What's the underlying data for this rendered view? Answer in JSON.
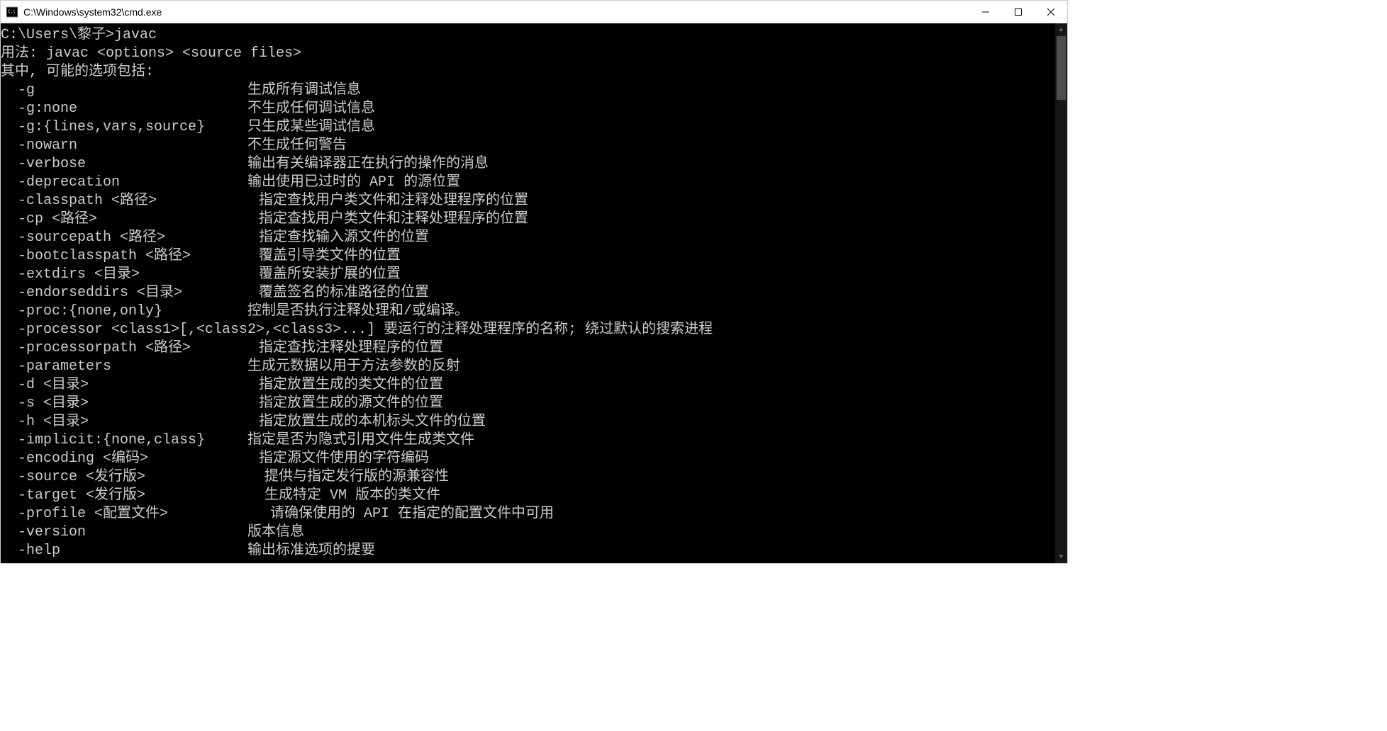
{
  "window": {
    "title": "C:\\Windows\\system32\\cmd.exe"
  },
  "terminal": {
    "prompt": "C:\\Users\\黎子>javac",
    "usage": "用法: javac <options> <source files>",
    "options_header": "其中, 可能的选项包括:",
    "options": [
      {
        "flag": "  -g                         ",
        "desc": "生成所有调试信息"
      },
      {
        "flag": "  -g:none                    ",
        "desc": "不生成任何调试信息"
      },
      {
        "flag": "  -g:{lines,vars,source}     ",
        "desc": "只生成某些调试信息"
      },
      {
        "flag": "  -nowarn                    ",
        "desc": "不生成任何警告"
      },
      {
        "flag": "  -verbose                   ",
        "desc": "输出有关编译器正在执行的操作的消息"
      },
      {
        "flag": "  -deprecation               ",
        "desc": "输出使用已过时的 API 的源位置"
      },
      {
        "flag": "  -classpath <路径>            ",
        "desc": "指定查找用户类文件和注释处理程序的位置"
      },
      {
        "flag": "  -cp <路径>                   ",
        "desc": "指定查找用户类文件和注释处理程序的位置"
      },
      {
        "flag": "  -sourcepath <路径>           ",
        "desc": "指定查找输入源文件的位置"
      },
      {
        "flag": "  -bootclasspath <路径>        ",
        "desc": "覆盖引导类文件的位置"
      },
      {
        "flag": "  -extdirs <目录>              ",
        "desc": "覆盖所安装扩展的位置"
      },
      {
        "flag": "  -endorseddirs <目录>         ",
        "desc": "覆盖签名的标准路径的位置"
      },
      {
        "flag": "  -proc:{none,only}          ",
        "desc": "控制是否执行注释处理和/或编译。"
      },
      {
        "flag": "  -processor <class1>[,<class2>,<class3>...] ",
        "desc": "要运行的注释处理程序的名称; 绕过默认的搜索进程"
      },
      {
        "flag": "  -processorpath <路径>        ",
        "desc": "指定查找注释处理程序的位置"
      },
      {
        "flag": "  -parameters                ",
        "desc": "生成元数据以用于方法参数的反射"
      },
      {
        "flag": "  -d <目录>                    ",
        "desc": "指定放置生成的类文件的位置"
      },
      {
        "flag": "  -s <目录>                    ",
        "desc": "指定放置生成的源文件的位置"
      },
      {
        "flag": "  -h <目录>                    ",
        "desc": "指定放置生成的本机标头文件的位置"
      },
      {
        "flag": "  -implicit:{none,class}     ",
        "desc": "指定是否为隐式引用文件生成类文件"
      },
      {
        "flag": "  -encoding <编码>             ",
        "desc": "指定源文件使用的字符编码"
      },
      {
        "flag": "  -source <发行版>              ",
        "desc": "提供与指定发行版的源兼容性"
      },
      {
        "flag": "  -target <发行版>              ",
        "desc": "生成特定 VM 版本的类文件"
      },
      {
        "flag": "  -profile <配置文件>            ",
        "desc": "请确保使用的 API 在指定的配置文件中可用"
      },
      {
        "flag": "  -version                   ",
        "desc": "版本信息"
      },
      {
        "flag": "  -help                      ",
        "desc": "输出标准选项的提要"
      }
    ]
  }
}
